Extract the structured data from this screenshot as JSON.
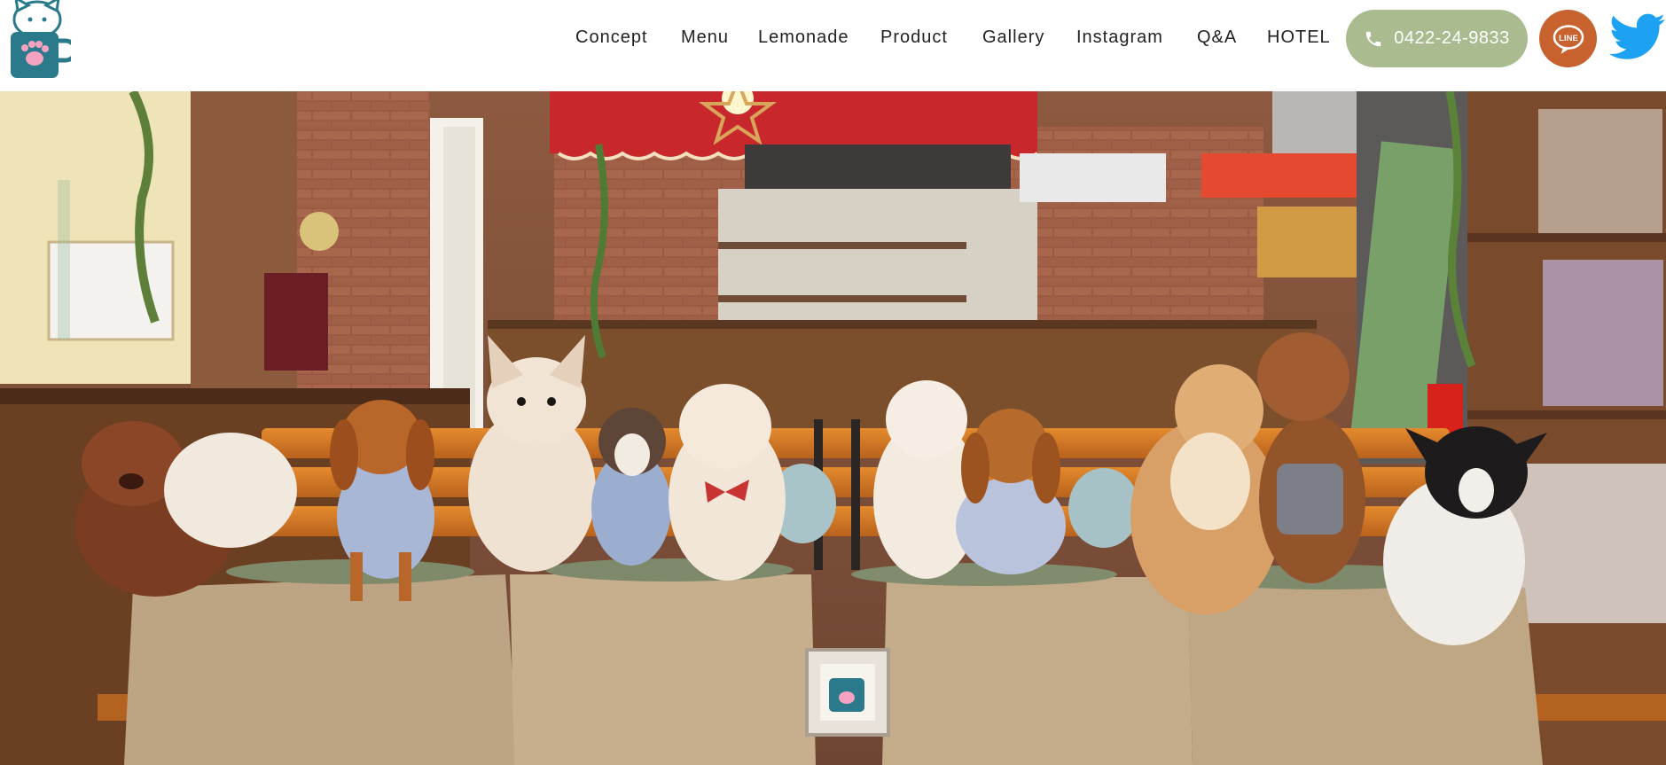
{
  "brand": {
    "logo_icon": "cat-in-mug-icon",
    "logo_mug_color": "#2a7a8c"
  },
  "nav": {
    "items": [
      {
        "label": "Concept"
      },
      {
        "label": "Menu"
      },
      {
        "label": "Lemonade"
      },
      {
        "label": "Product"
      },
      {
        "label": "Gallery"
      },
      {
        "label": "Instagram"
      },
      {
        "label": "Q&A"
      },
      {
        "label": "HOTEL"
      }
    ]
  },
  "contact": {
    "phone_label": "0422-24-9833",
    "phone_icon": "phone-icon",
    "phone_bg": "#a9bb8f",
    "line_label": "LINE",
    "line_icon": "line-chat-icon",
    "line_bg": "#c8622f",
    "twitter_icon": "twitter-bird-icon",
    "twitter_color": "#1da1f2"
  },
  "hero": {
    "photo_icon": "dog-cafe-photo",
    "frame_mug_label": ""
  }
}
